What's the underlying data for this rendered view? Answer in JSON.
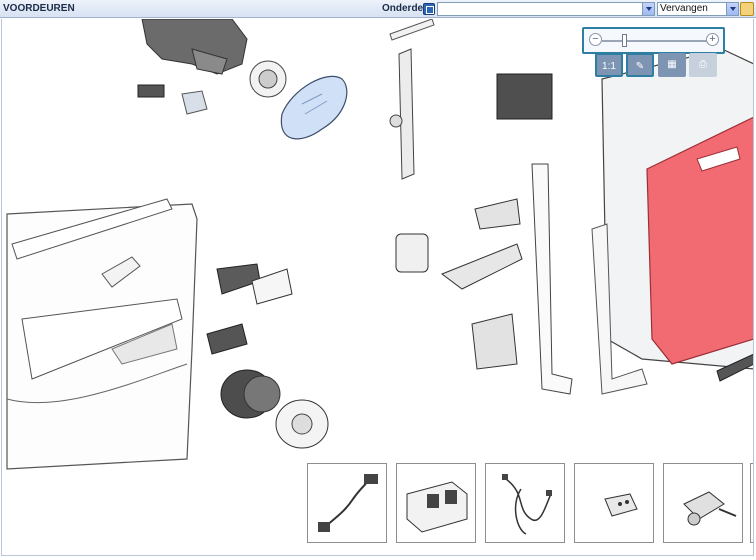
{
  "toolbar": {
    "title": "VOORDEUREN",
    "onderdeel_label": "Onderdeel",
    "onderdeel_value": "",
    "action_value": "Vervangen"
  },
  "zoom": {
    "minus_symbol": "−",
    "plus_symbol": "+",
    "level_percent": 22
  },
  "view_buttons": [
    {
      "label": "1:1"
    },
    {
      "label": ""
    },
    {
      "label": ""
    },
    {
      "label": ""
    }
  ],
  "thumbnails": [
    {
      "icon": "cable-connector-icon"
    },
    {
      "icon": "window-switch-panel-icon"
    },
    {
      "icon": "wiring-harness-icon"
    },
    {
      "icon": "remote-key-icon"
    },
    {
      "icon": "lock-cylinder-key-icon"
    }
  ],
  "colors": {
    "highlight_part": "#f26b73",
    "highlight_frame": "#2e7ea3",
    "mirror_glass": "#cfe0f7",
    "dark_part": "#595959"
  }
}
